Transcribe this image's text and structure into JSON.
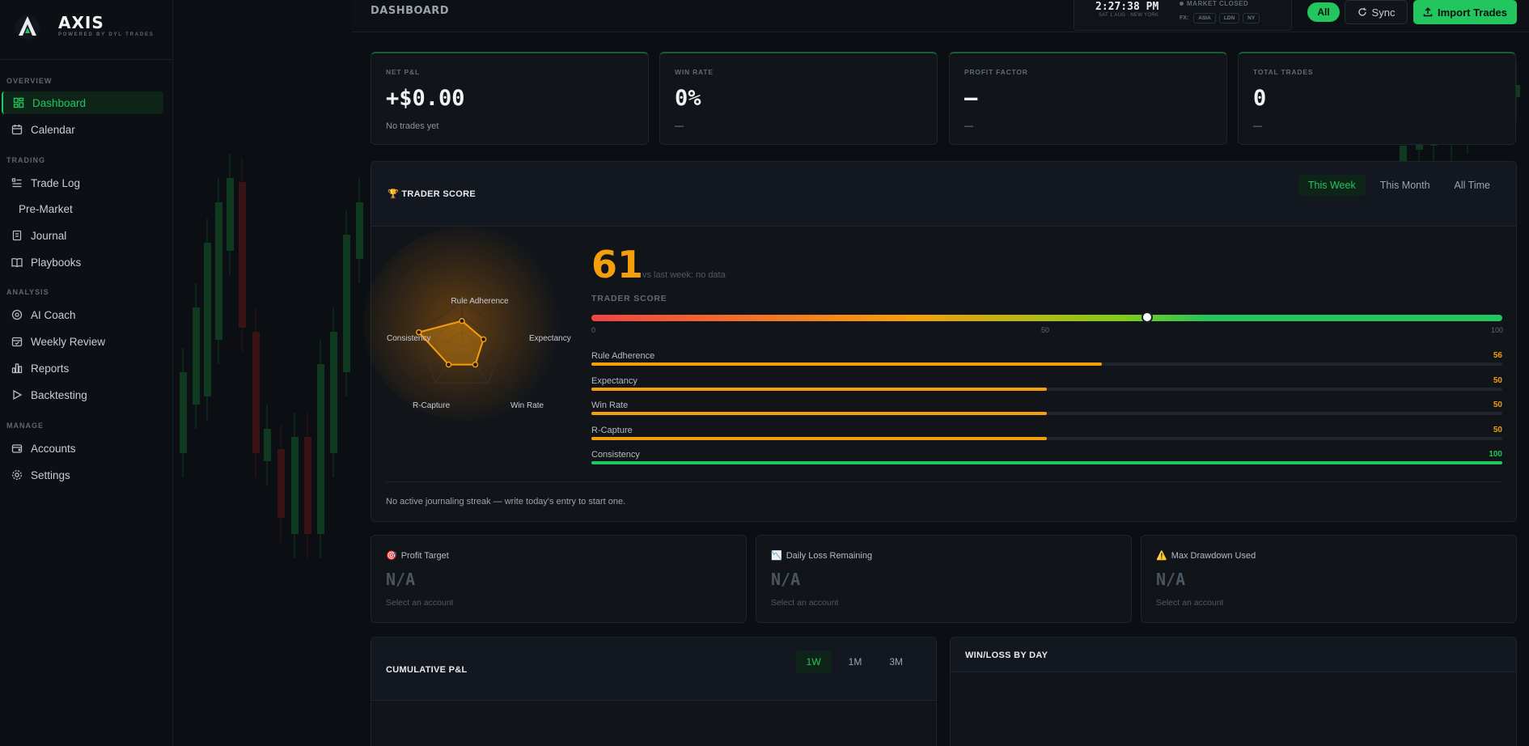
{
  "brand": {
    "name": "AXIS",
    "tagline": "POWERED BY DYL TRADES"
  },
  "sidebar": {
    "sections": [
      {
        "label": "OVERVIEW",
        "items": [
          {
            "label": "Dashboard",
            "icon": "dashboard-icon",
            "active": true
          },
          {
            "label": "Calendar",
            "icon": "calendar-icon"
          }
        ]
      },
      {
        "label": "TRADING",
        "items": [
          {
            "label": "Trade Log",
            "icon": "list-icon"
          },
          {
            "label": "Pre-Market",
            "icon": ""
          },
          {
            "label": "Journal",
            "icon": "journal-icon"
          },
          {
            "label": "Playbooks",
            "icon": "book-icon"
          }
        ]
      },
      {
        "label": "ANALYSIS",
        "items": [
          {
            "label": "AI Coach",
            "icon": "ai-icon"
          },
          {
            "label": "Weekly Review",
            "icon": "calendar-check-icon"
          },
          {
            "label": "Reports",
            "icon": "bar-chart-icon"
          },
          {
            "label": "Backtesting",
            "icon": "play-icon"
          }
        ]
      },
      {
        "label": "MANAGE",
        "items": [
          {
            "label": "Accounts",
            "icon": "wallet-icon"
          },
          {
            "label": "Settings",
            "icon": "gear-icon"
          }
        ]
      }
    ]
  },
  "topbar": {
    "title": "DASHBOARD",
    "clock": {
      "time": "2:27:38 PM",
      "date": "SAT 1 AUG · NEW YORK"
    },
    "market_status": "MARKET CLOSED",
    "fx_label": "FX:",
    "fx_sessions": [
      "ASIA",
      "LDN",
      "NY"
    ],
    "filter_all": "All",
    "sync_label": "Sync",
    "import_label": "Import Trades"
  },
  "stats": [
    {
      "label": "NET P&L",
      "value": "+$0.00",
      "sub": "No trades yet"
    },
    {
      "label": "WIN RATE",
      "value": "0%",
      "sub": "—"
    },
    {
      "label": "PROFIT FACTOR",
      "value": "—",
      "sub": "—"
    },
    {
      "label": "TOTAL TRADES",
      "value": "0",
      "sub": "—"
    }
  ],
  "trader_score": {
    "icon": "🏆",
    "title": "TRADER SCORE",
    "tabs": [
      "This Week",
      "This Month",
      "All Time"
    ],
    "active_tab": "This Week",
    "score": 61,
    "score_text": "61",
    "vs_text": "vs last week: no data",
    "label": "TRADER SCORE",
    "scale_ticks": [
      "0",
      "50",
      "100"
    ],
    "metrics": [
      {
        "name": "Rule Adherence",
        "value": 56,
        "value_text": "56",
        "color": "#f59e0b"
      },
      {
        "name": "Expectancy",
        "value": 50,
        "value_text": "50",
        "color": "#f59e0b"
      },
      {
        "name": "Win Rate",
        "value": 50,
        "value_text": "50",
        "color": "#f59e0b"
      },
      {
        "name": "R-Capture",
        "value": 50,
        "value_text": "50",
        "color": "#f59e0b"
      },
      {
        "name": "Consistency",
        "value": 100,
        "value_text": "100",
        "color": "#22c55e"
      }
    ],
    "radar_labels": {
      "top": "Rule Adherence",
      "right": "Expectancy",
      "bottom_right": "Win Rate",
      "bottom_left": "R-Capture",
      "left": "Consistency"
    },
    "streak": "No active journaling streak — write today's entry to start one."
  },
  "accounts": [
    {
      "icon": "🎯",
      "title": "Profit Target",
      "value": "N/A",
      "sub": "Select an account"
    },
    {
      "icon": "📉",
      "title": "Daily Loss Remaining",
      "value": "N/A",
      "sub": "Select an account"
    },
    {
      "icon": "⚠️",
      "title": "Max Drawdown Used",
      "value": "N/A",
      "sub": "Select an account"
    }
  ],
  "cumulative": {
    "title": "CUMULATIVE P&L",
    "periods": [
      "1W",
      "1M",
      "3M"
    ],
    "active_period": "1W"
  },
  "winloss": {
    "title": "WIN/LOSS BY DAY"
  },
  "colors": {
    "accent": "#22c55e",
    "warning": "#f59e0b",
    "danger": "#ef4444",
    "background": "#0b0e12"
  }
}
